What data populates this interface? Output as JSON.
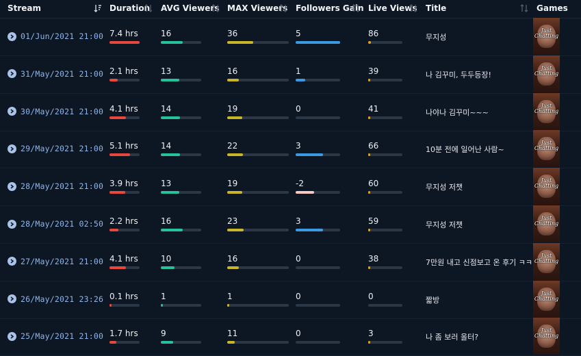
{
  "columns": {
    "stream": "Stream",
    "duration": "Duration",
    "avg": "AVG Viewers",
    "max": "MAX Viewers",
    "followers": "Followers Gain",
    "views": "Live Views",
    "title": "Title",
    "games": "Games"
  },
  "colors": {
    "duration": "#e8473e",
    "avg": "#26c29a",
    "max": "#c8b528",
    "followers_pos": "#3b9ae1",
    "followers_neg": "#f3c8c2",
    "views": "#e3a020",
    "track": "#2c3746"
  },
  "game_thumbnail_text": "Just Chatting",
  "rows": [
    {
      "stream": "01/Jun/2021 21:00",
      "duration": "7.4 hrs",
      "duration_frac": 1.0,
      "avg": "16",
      "avg_frac": 0.55,
      "max": "36",
      "max_frac": 0.42,
      "followers": "5",
      "followers_frac": 1.0,
      "followers_neg": false,
      "views": "86",
      "views_frac": 0.08,
      "title": "무지성"
    },
    {
      "stream": "31/May/2021 21:00",
      "duration": "2.1 hrs",
      "duration_frac": 0.28,
      "avg": "13",
      "avg_frac": 0.45,
      "max": "16",
      "max_frac": 0.19,
      "followers": "1",
      "followers_frac": 0.21,
      "followers_neg": false,
      "views": "39",
      "views_frac": 0.03,
      "title": "나 김꾸미, 두두등장!"
    },
    {
      "stream": "30/May/2021 21:00",
      "duration": "4.1 hrs",
      "duration_frac": 0.55,
      "avg": "14",
      "avg_frac": 0.48,
      "max": "19",
      "max_frac": 0.24,
      "followers": "0",
      "followers_frac": 0.0,
      "followers_neg": false,
      "views": "41",
      "views_frac": 0.04,
      "title": "나야나 김꾸미~~~"
    },
    {
      "stream": "29/May/2021 21:00",
      "duration": "5.1 hrs",
      "duration_frac": 0.69,
      "avg": "14",
      "avg_frac": 0.48,
      "max": "22",
      "max_frac": 0.26,
      "followers": "3",
      "followers_frac": 0.62,
      "followers_neg": false,
      "views": "66",
      "views_frac": 0.06,
      "title": "10분 전에 일어난 사람~"
    },
    {
      "stream": "28/May/2021 21:00",
      "duration": "3.9 hrs",
      "duration_frac": 0.53,
      "avg": "13",
      "avg_frac": 0.45,
      "max": "19",
      "max_frac": 0.24,
      "followers": "-2",
      "followers_frac": 0.42,
      "followers_neg": true,
      "views": "60",
      "views_frac": 0.06,
      "title": "무지성 저챗"
    },
    {
      "stream": "28/May/2021 02:50",
      "duration": "2.2 hrs",
      "duration_frac": 0.3,
      "avg": "16",
      "avg_frac": 0.55,
      "max": "23",
      "max_frac": 0.27,
      "followers": "3",
      "followers_frac": 0.62,
      "followers_neg": false,
      "views": "59",
      "views_frac": 0.06,
      "title": "무지성 저챗"
    },
    {
      "stream": "27/May/2021 21:00",
      "duration": "4.1 hrs",
      "duration_frac": 0.55,
      "avg": "10",
      "avg_frac": 0.34,
      "max": "16",
      "max_frac": 0.19,
      "followers": "0",
      "followers_frac": 0.0,
      "followers_neg": false,
      "views": "38",
      "views_frac": 0.03,
      "title": "7만원 내고 신점보고 온 후기 ㅋㅋ"
    },
    {
      "stream": "26/May/2021 23:26",
      "duration": "0.1 hrs",
      "duration_frac": 0.02,
      "avg": "1",
      "avg_frac": 0.03,
      "max": "1",
      "max_frac": 0.01,
      "followers": "0",
      "followers_frac": 0.0,
      "followers_neg": false,
      "views": "0",
      "views_frac": 0.0,
      "title": "짧방"
    },
    {
      "stream": "25/May/2021 21:00",
      "duration": "1.7 hrs",
      "duration_frac": 0.23,
      "avg": "9",
      "avg_frac": 0.31,
      "max": "11",
      "max_frac": 0.12,
      "followers": "0",
      "followers_frac": 0.0,
      "followers_neg": false,
      "views": "3",
      "views_frac": 0.01,
      "title": "나 좀 보러 올터?"
    }
  ]
}
